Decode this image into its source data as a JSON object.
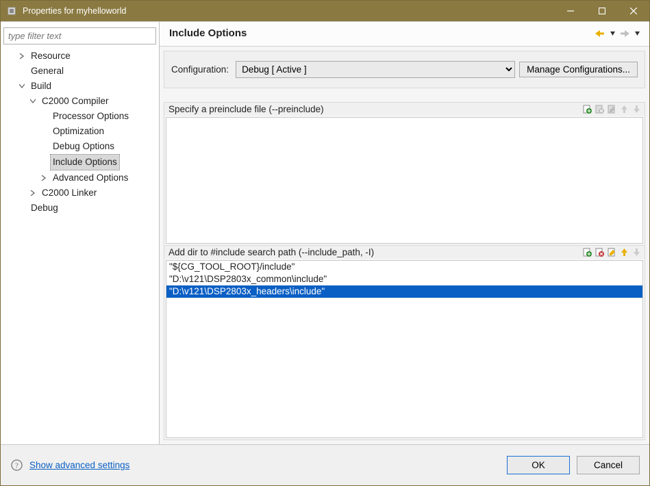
{
  "window": {
    "title": "Properties for myhelloworld"
  },
  "filter": {
    "placeholder": "type filter text"
  },
  "tree": {
    "resource": "Resource",
    "general": "General",
    "build": "Build",
    "compiler": "C2000 Compiler",
    "processor": "Processor Options",
    "optimization": "Optimization",
    "debug": "Debug Options",
    "include": "Include Options",
    "advanced": "Advanced Options",
    "linker": "C2000 Linker",
    "dbg": "Debug"
  },
  "page": {
    "title": "Include Options",
    "configLabel": "Configuration:",
    "configValue": "Debug  [ Active ]",
    "manage": "Manage Configurations...",
    "panel1": {
      "title": "Specify a preinclude file (--preinclude)",
      "rows": []
    },
    "panel2": {
      "title": "Add dir to #include search path (--include_path, -I)",
      "rows": [
        {
          "text": "\"${CG_TOOL_ROOT}/include\"",
          "selected": false
        },
        {
          "text": "\"D:\\v121\\DSP2803x_common\\include\"",
          "selected": false
        },
        {
          "text": "\"D:\\v121\\DSP2803x_headers\\include\"",
          "selected": true
        }
      ]
    }
  },
  "footer": {
    "advanced": "Show advanced settings",
    "ok": "OK",
    "cancel": "Cancel"
  }
}
